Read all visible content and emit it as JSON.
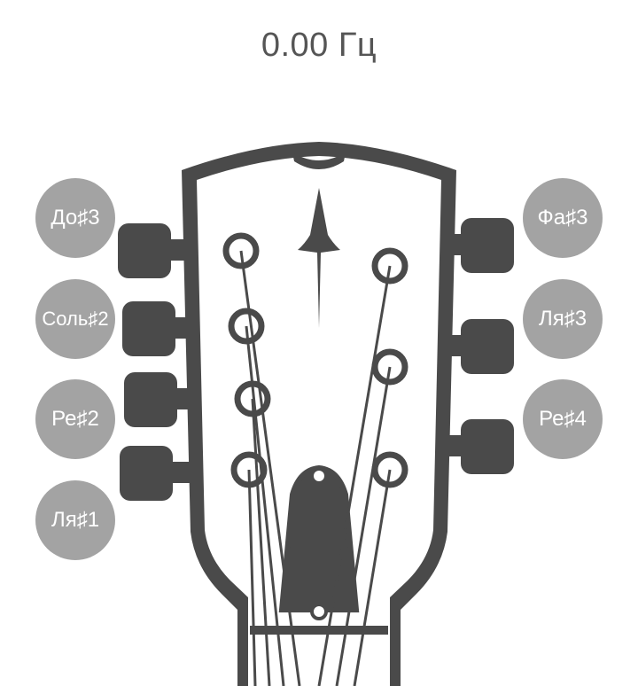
{
  "frequency": {
    "text": "0.00 Гц"
  },
  "strings": {
    "left": [
      {
        "label": "До♯3"
      },
      {
        "label": "Соль♯2"
      },
      {
        "label": "Ре♯2"
      },
      {
        "label": "Ля♯1"
      }
    ],
    "right": [
      {
        "label": "Фа♯3"
      },
      {
        "label": "Ля♯3"
      },
      {
        "label": "Ре♯4"
      }
    ]
  },
  "colors": {
    "text": "#555555",
    "note_bg": "#a3a3a3",
    "guitar": "#4a4a4a"
  }
}
